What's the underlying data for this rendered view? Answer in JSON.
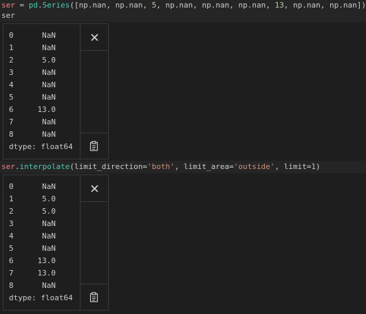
{
  "cell1": {
    "line1": {
      "var": "ser",
      "eq": " = ",
      "mod": "pd",
      "dot": ".",
      "fn": "Series",
      "open": "([",
      "nan1": "np.nan",
      "c1": ", ",
      "nan2": "np.nan",
      "c2": ", ",
      "n5": "5",
      "c3": ", ",
      "nan3": "np.nan",
      "c4": ", ",
      "nan4": "np.nan",
      "c5": ", ",
      "nan5": "np.nan",
      "c6": ", ",
      "n13": "13",
      "c7": ", ",
      "nan6": "np.nan",
      "c8": ", ",
      "nan7": "np.nan",
      "close": "])"
    },
    "line2": "ser",
    "output": {
      "rows": [
        {
          "idx": "0",
          "val": "NaN"
        },
        {
          "idx": "1",
          "val": "NaN"
        },
        {
          "idx": "2",
          "val": "5.0"
        },
        {
          "idx": "3",
          "val": "NaN"
        },
        {
          "idx": "4",
          "val": "NaN"
        },
        {
          "idx": "5",
          "val": "NaN"
        },
        {
          "idx": "6",
          "val": "13.0"
        },
        {
          "idx": "7",
          "val": "NaN"
        },
        {
          "idx": "8",
          "val": "NaN"
        }
      ],
      "dtype": "dtype: float64"
    }
  },
  "cell2": {
    "line1": {
      "var": "ser",
      "dot": ".",
      "fn": "interpolate",
      "open": "(",
      "arg1": "limit_direction=",
      "s1": "'both'",
      "c1": ", ",
      "arg2": "limit_area=",
      "s2": "'outside'",
      "c2": ", ",
      "arg3": "limit=",
      "n1": "1",
      "close": ")"
    },
    "output": {
      "rows": [
        {
          "idx": "0",
          "val": "NaN"
        },
        {
          "idx": "1",
          "val": "5.0"
        },
        {
          "idx": "2",
          "val": "5.0"
        },
        {
          "idx": "3",
          "val": "NaN"
        },
        {
          "idx": "4",
          "val": "NaN"
        },
        {
          "idx": "5",
          "val": "NaN"
        },
        {
          "idx": "6",
          "val": "13.0"
        },
        {
          "idx": "7",
          "val": "13.0"
        },
        {
          "idx": "8",
          "val": "NaN"
        }
      ],
      "dtype": "dtype: float64"
    }
  },
  "icons": {
    "close": "close-icon",
    "copy": "copy-clipboard-icon"
  },
  "colors": {
    "background": "#1e1e1e",
    "variable": "#f08080",
    "function": "#4ec9b0",
    "number": "#b5cea8",
    "string": "#ce9178"
  }
}
